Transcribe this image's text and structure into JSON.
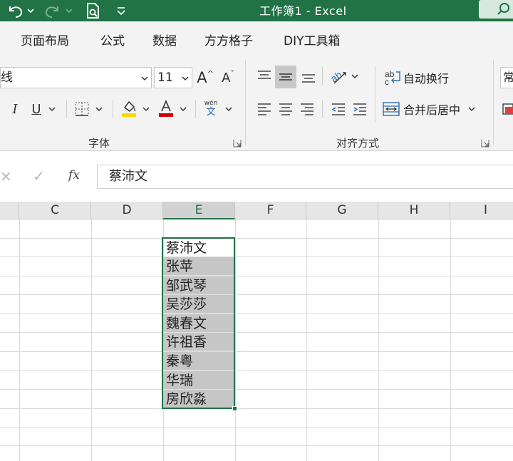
{
  "titlebar": {
    "title": "工作簿1  -  Excel"
  },
  "tabs": [
    "页面布局",
    "公式",
    "数据",
    "方方格子",
    "DIY工具箱"
  ],
  "ribbon": {
    "font_name": "线",
    "font_size": "11",
    "grow_font_label": "A",
    "shrink_font_label": "A",
    "italic_label": "I",
    "underline_label": "U",
    "phonetic_label": "wén",
    "phonetic_char": "文",
    "wrap_text_label": "自动换行",
    "merge_center_label": "合并后居中",
    "font_group_label": "字体",
    "alignment_group_label": "对齐方式",
    "next_group_partial": "常",
    "colors": {
      "fill_color": "#ffd700",
      "font_color": "#d00000",
      "accent": "#217346"
    }
  },
  "formula_bar": {
    "cancel_symbol": "×",
    "enter_symbol": "✓",
    "fx_label": "fx",
    "value": "蔡沛文"
  },
  "grid": {
    "columns": [
      "C",
      "D",
      "E",
      "F",
      "G",
      "H",
      "I"
    ],
    "selected_column": "E",
    "cells": [
      "蔡沛文",
      "张苹",
      "邹武琴",
      "吴莎莎",
      "魏春文",
      "许祖香",
      "秦粤",
      "华瑞",
      "房欣淼"
    ]
  }
}
